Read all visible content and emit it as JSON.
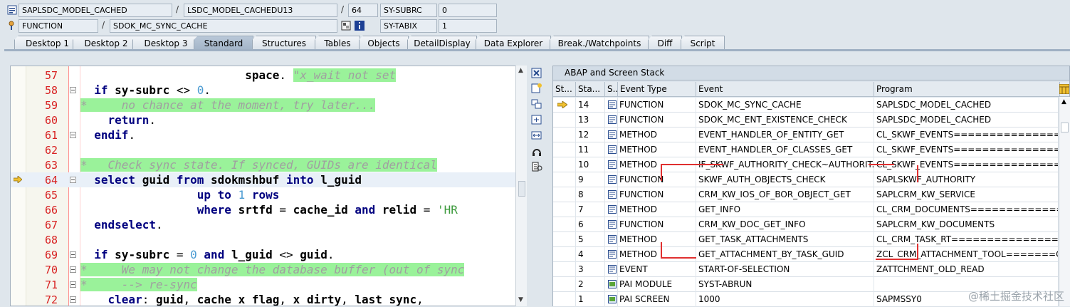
{
  "header": {
    "row1": {
      "program": "SAPLSDC_MODEL_CACHED",
      "include": "LSDC_MODEL_CACHEDU13",
      "line": "64",
      "sysvar_label": "SY-SUBRC",
      "sysvar_value": "0"
    },
    "row2": {
      "type": "FUNCTION",
      "name": "SDOK_MC_SYNC_CACHE",
      "sysvar_label": "SY-TABIX",
      "sysvar_value": "1"
    }
  },
  "tabs": [
    "Desktop 1",
    "Desktop 2",
    "Desktop 3",
    "Standard",
    "Structures",
    "Tables",
    "Objects",
    "DetailDisplay",
    "Data Explorer",
    "Break./Watchpoints",
    "Diff",
    "Script"
  ],
  "active_tab": "Standard",
  "code": {
    "lines": [
      {
        "n": "57",
        "html": "                        <span class='pl'>space</span>. <span class='cmt'>\"x_wait not set</span>"
      },
      {
        "n": "58",
        "html": "  <span class='kw'>if</span> <span class='pl'>sy-subrc</span> &lt;&gt; <span class='num'>0</span>."
      },
      {
        "n": "59",
        "html": "<span class='cmt'>*     no chance at the moment, try later...</span>"
      },
      {
        "n": "60",
        "html": "    <span class='kw'>return</span>."
      },
      {
        "n": "61",
        "html": "  <span class='kw'>endif</span>."
      },
      {
        "n": "62",
        "html": ""
      },
      {
        "n": "63",
        "html": "<span class='cmt'>*   Check sync state. If synced, GUIDs are identical</span>"
      },
      {
        "n": "64",
        "html": "  <span class='kw'>select</span> <span class='pl'>guid</span> <span class='kw'>from</span> <span class='pl'>sdokmshbuf</span> <span class='kw'>into</span> <span class='pl'>l_guid</span>"
      },
      {
        "n": "65",
        "html": "                 <span class='kw'>up to</span> <span class='num'>1</span> <span class='kw'>rows</span>"
      },
      {
        "n": "66",
        "html": "                 <span class='kw'>where</span> <span class='pl'>srtfd</span> = <span class='pl'>cache_id</span> <span class='kw'>and</span> <span class='pl'>relid</span> = <span class='str'>'HR</span>"
      },
      {
        "n": "67",
        "html": "  <span class='kw'>endselect</span>."
      },
      {
        "n": "68",
        "html": ""
      },
      {
        "n": "69",
        "html": "  <span class='kw'>if</span> <span class='pl'>sy-subrc</span> = <span class='num'>0</span> <span class='kw'>and</span> <span class='pl'>l_guid</span> &lt;&gt; <span class='pl'>guid</span>."
      },
      {
        "n": "70",
        "html": "<span class='cmt'>*     We may not change the database buffer (out of sync</span>"
      },
      {
        "n": "71",
        "html": "<span class='cmt'>*     --&gt; re-sync</span>"
      },
      {
        "n": "72",
        "html": "    <span class='kw'>clear</span>: <span class='pl'>guid</span>, <span class='pl'>cache</span> <span class='pl'>x</span> <span class='pl'>flag</span>, <span class='pl'>x</span> <span class='pl'>dirty</span>, <span class='pl'>last</span> <span class='pl'>sync</span>,"
      }
    ]
  },
  "stack": {
    "title": "ABAP and Screen Stack",
    "columns": [
      "St...",
      "Sta...",
      "S...",
      "Event Type",
      "Event",
      "Program"
    ],
    "rows": [
      {
        "level": "14",
        "type": "FUNCTION",
        "event": "SDOK_MC_SYNC_CACHE",
        "program": "SAPLSDC_MODEL_CACHED",
        "current": true
      },
      {
        "level": "13",
        "type": "FUNCTION",
        "event": "SDOK_MC_ENT_EXISTENCE_CHECK",
        "program": "SAPLSDC_MODEL_CACHED"
      },
      {
        "level": "12",
        "type": "METHOD",
        "event": "EVENT_HANDLER_OF_ENTITY_GET",
        "program": "CL_SKWF_EVENTS================C"
      },
      {
        "level": "11",
        "type": "METHOD",
        "event": "EVENT_HANDLER_OF_CLASSES_GET",
        "program": "CL_SKWF_EVENTS================C"
      },
      {
        "level": "10",
        "type": "METHOD",
        "event": "IF_SKWF_AUTHORITY_CHECK~AUTHORIT...",
        "program": "CL_SKWF_EVENTS================C"
      },
      {
        "level": "9",
        "type": "FUNCTION",
        "event": "SKWF_AUTH_OBJECTS_CHECK",
        "program": "SAPLSKWF_AUTHORITY"
      },
      {
        "level": "8",
        "type": "FUNCTION",
        "event": "CRM_KW_IOS_OF_BOR_OBJECT_GET",
        "program": "SAPLCRM_KW_SERVICE"
      },
      {
        "level": "7",
        "type": "METHOD",
        "event": "GET_INFO",
        "program": "CL_CRM_DOCUMENTS==============C"
      },
      {
        "level": "6",
        "type": "FUNCTION",
        "event": "CRM_KW_DOC_GET_INFO",
        "program": "SAPLCRM_KW_DOCUMENTS"
      },
      {
        "level": "5",
        "type": "METHOD",
        "event": "GET_TASK_ATTACHMENTS",
        "program": "CL_CRM_TASK_RT================CI"
      },
      {
        "level": "4",
        "type": "METHOD",
        "event": "GET_ATTACHMENT_BY_TASK_GUID",
        "program": "ZCL_CRM_ATTACHMENT_TOOL=======CP"
      },
      {
        "level": "3",
        "type": "EVENT",
        "event": "START-OF-SELECTION",
        "program": "ZATTCHMENT_OLD_READ"
      },
      {
        "level": "2",
        "type": "PAI MODULE",
        "event": "SYST-ABRUN",
        "program": ""
      },
      {
        "level": "1",
        "type": "PAI SCREEN",
        "event": "1000",
        "program": "SAPMSSY0"
      }
    ]
  },
  "watermark": "@稀土掘金技术社区",
  "colors": {
    "comment_bg": "#9af29a",
    "keyword": "#00007f",
    "line_number": "#d82121",
    "annotation_red": "#e03030"
  }
}
